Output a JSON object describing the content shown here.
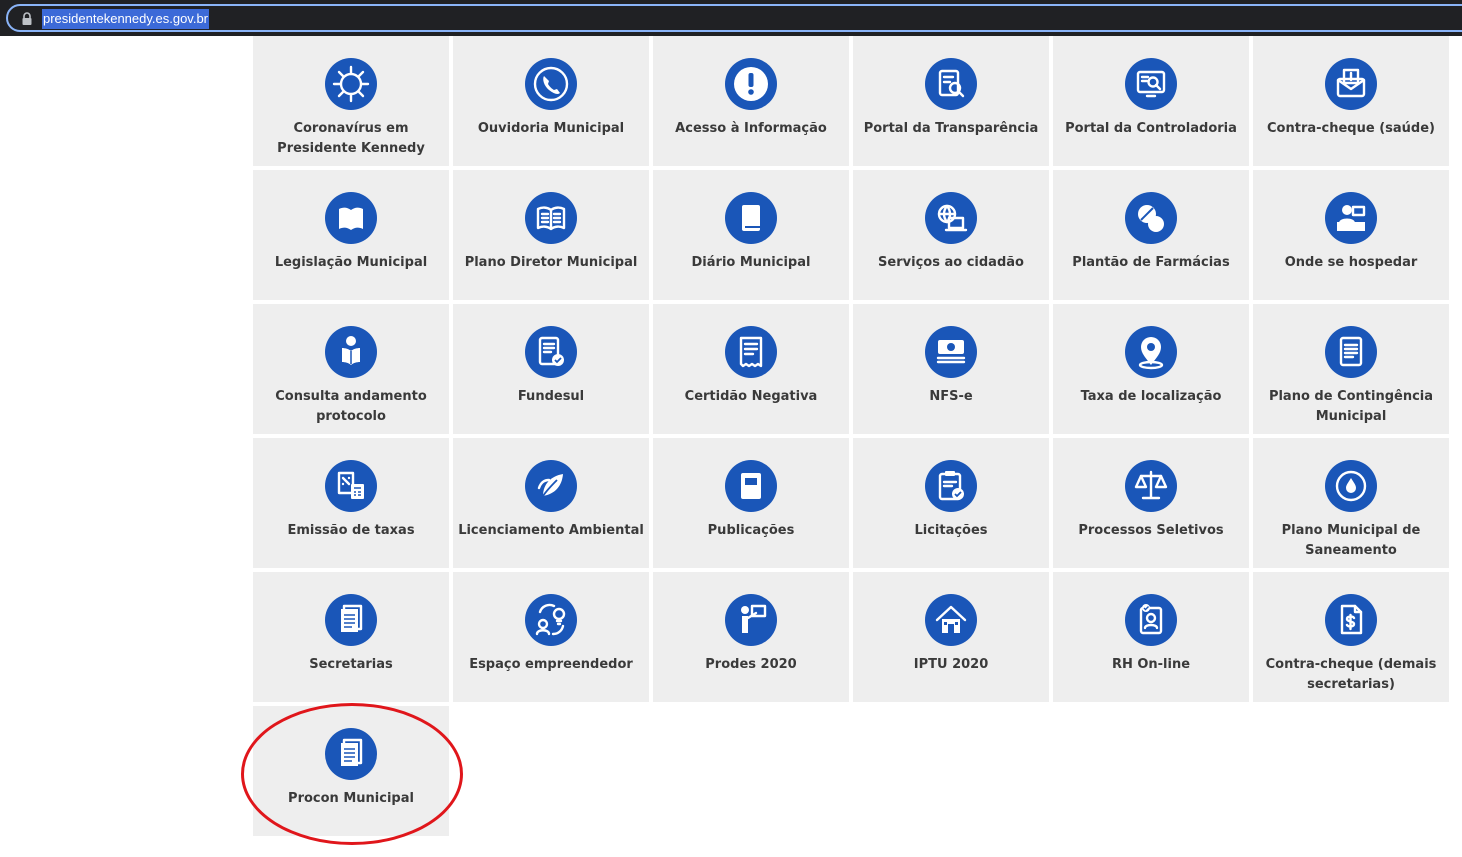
{
  "browser": {
    "url": "presidentekennedy.es.gov.br"
  },
  "colors": {
    "icon_circle": "#1a56b8",
    "tile_bg": "#eeeeee",
    "label_text": "#3a3a3a",
    "annotation": "#e0161b"
  },
  "tiles": [
    {
      "label": "Coronavírus em Presidente Kennedy",
      "lines": [
        "Coronavírus em",
        "Presidente Kennedy"
      ],
      "icon": "virus-icon"
    },
    {
      "label": "Ouvidoria Municipal",
      "lines": [
        "Ouvidoria Municipal"
      ],
      "icon": "phone-icon"
    },
    {
      "label": "Acesso à Informação",
      "lines": [
        "Acesso à Informação"
      ],
      "icon": "exclamation-icon"
    },
    {
      "label": "Portal da Transparência",
      "lines": [
        "Portal da Transparência"
      ],
      "icon": "document-search-icon"
    },
    {
      "label": "Portal da Controladoria",
      "lines": [
        "Portal da Controladoria"
      ],
      "icon": "monitor-search-icon"
    },
    {
      "label": "Contra-cheque (saúde)",
      "lines": [
        "Contra-cheque (saúde)"
      ],
      "icon": "envelope-money-icon"
    },
    {
      "label": "Legislação Municipal",
      "lines": [
        "Legislação Municipal"
      ],
      "icon": "open-book-icon"
    },
    {
      "label": "Plano Diretor Municipal",
      "lines": [
        "Plano Diretor Municipal"
      ],
      "icon": "reading-book-icon"
    },
    {
      "label": "Diário Municipal",
      "lines": [
        "Diário Municipal"
      ],
      "icon": "closed-book-icon"
    },
    {
      "label": "Serviços ao cidadão",
      "lines": [
        "Serviços ao cidadão"
      ],
      "icon": "globe-laptop-icon"
    },
    {
      "label": "Plantão de Farmácias",
      "lines": [
        "Plantão de Farmácias"
      ],
      "icon": "pills-icon"
    },
    {
      "label": "Onde se hospedar",
      "lines": [
        "Onde se hospedar"
      ],
      "icon": "reception-icon"
    },
    {
      "label": "Consulta andamento protocolo",
      "lines": [
        "Consulta andamento",
        "protocolo"
      ],
      "icon": "person-reading-icon"
    },
    {
      "label": "Fundesul",
      "lines": [
        "Fundesul"
      ],
      "icon": "document-check-icon"
    },
    {
      "label": "Certidão Negativa",
      "lines": [
        "Certidão Negativa"
      ],
      "icon": "receipt-icon"
    },
    {
      "label": "NFS-e",
      "lines": [
        "NFS-e"
      ],
      "icon": "money-stack-icon"
    },
    {
      "label": "Taxa de localização",
      "lines": [
        "Taxa de localização"
      ],
      "icon": "map-pin-icon"
    },
    {
      "label": "Plano de Contingência Municipal",
      "lines": [
        "Plano de Contingência",
        "Municipal"
      ],
      "icon": "document-lines-icon"
    },
    {
      "label": "Emissão de taxas",
      "lines": [
        "Emissão de taxas"
      ],
      "icon": "calculator-percent-icon"
    },
    {
      "label": "Licenciamento Ambiental",
      "lines": [
        "Licenciamento Ambiental"
      ],
      "icon": "leaf-icon"
    },
    {
      "label": "Publicações",
      "lines": [
        "Publicações"
      ],
      "icon": "book-icon"
    },
    {
      "label": "Licitações",
      "lines": [
        "Licitações"
      ],
      "icon": "clipboard-check-icon"
    },
    {
      "label": "Processos Seletivos",
      "lines": [
        "Processos Seletivos"
      ],
      "icon": "scales-icon"
    },
    {
      "label": "Plano Municipal de Saneamento",
      "lines": [
        "Plano Municipal de",
        "Saneamento"
      ],
      "icon": "water-cycle-icon"
    },
    {
      "label": "Secretarias",
      "lines": [
        "Secretarias"
      ],
      "icon": "stacked-documents-icon"
    },
    {
      "label": "Espaço empreendedor",
      "lines": [
        "Espaço empreendedor"
      ],
      "icon": "entrepreneur-icon"
    },
    {
      "label": "Prodes 2020",
      "lines": [
        "Prodes 2020"
      ],
      "icon": "presenter-icon"
    },
    {
      "label": "IPTU 2020",
      "lines": [
        "IPTU 2020"
      ],
      "icon": "house-icon"
    },
    {
      "label": "RH On-line",
      "lines": [
        "RH On-line"
      ],
      "icon": "id-badge-icon"
    },
    {
      "label": "Contra-cheque (demais secretarias)",
      "lines": [
        "Contra-cheque (demais",
        "secretarias)"
      ],
      "icon": "document-dollar-icon"
    },
    {
      "label": "Procon Municipal",
      "lines": [
        "Procon Municipal"
      ],
      "icon": "stacked-documents-icon"
    }
  ]
}
